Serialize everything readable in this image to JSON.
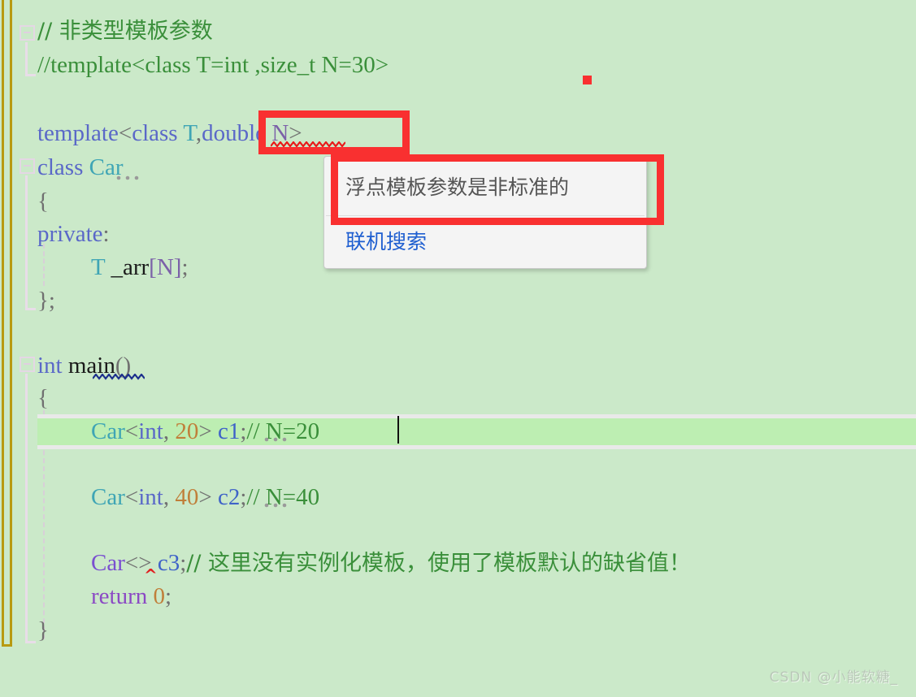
{
  "editor": {
    "background_color": "#cbe9c9",
    "current_line_color": "#bdeeb2",
    "change_bar_color": "#b89a10",
    "annotation_color": "#f93030"
  },
  "code": {
    "lines": [
      {
        "indent": 0,
        "text": "// 非类型模板参数"
      },
      {
        "indent": 0,
        "text": "//template<class T=int ,size_t N=30>"
      },
      {
        "indent": 0,
        "text": ""
      },
      {
        "indent": 0,
        "text": "template<class T,double N>"
      },
      {
        "indent": 0,
        "text": "class Car"
      },
      {
        "indent": 0,
        "text": "{"
      },
      {
        "indent": 0,
        "text": "private:"
      },
      {
        "indent": 1,
        "text": "T _arr[N];"
      },
      {
        "indent": 0,
        "text": "};"
      },
      {
        "indent": 0,
        "text": ""
      },
      {
        "indent": 0,
        "text": "int main()"
      },
      {
        "indent": 0,
        "text": "{"
      },
      {
        "indent": 1,
        "text": "Car<int, 20> c1;// N=20"
      },
      {
        "indent": 1,
        "text": ""
      },
      {
        "indent": 1,
        "text": "Car<int, 40> c2;// N=40"
      },
      {
        "indent": 1,
        "text": ""
      },
      {
        "indent": 1,
        "text": "Car<> c3;// 这里没有实例化模板，使用了模板默认的缺省值！"
      },
      {
        "indent": 1,
        "text": "return 0;"
      },
      {
        "indent": 0,
        "text": "}"
      }
    ],
    "tokens": {
      "comment_line_1": "// 非类型模板参数",
      "comment_line_2": "//template<class T=int ,size_t N=30>",
      "kw_template": "template",
      "lt": "<",
      "kw_class": "class",
      "t_param": "T",
      "comma": ",",
      "kw_double": "double",
      "n_param": "N",
      "gt": ">",
      "class_name": "Car",
      "open_brace": "{",
      "kw_private": "private",
      "colon": ":",
      "member_type": "T",
      "member_name": "_arr",
      "bracket_open": "[",
      "bracket_n": "N",
      "bracket_close": "]",
      "semi": ";",
      "close_brace_semi": "};",
      "kw_int": "int",
      "fn_main": "main",
      "parens": "()",
      "car": "Car",
      "int_arg": "int",
      "num_20": "20",
      "num_40": "40",
      "var_c1": "c1",
      "var_c2": "c2",
      "var_c3": "c3",
      "cmt_n20": "// N=20",
      "cmt_n40": "// N=40",
      "cmt_c3": "// 这里没有实例化模板，使用了模板默认的缺省值！",
      "kw_return": "return",
      "num_0": "0",
      "close_brace": "}",
      "empty_args": "<>"
    }
  },
  "tooltip": {
    "message": "浮点模板参数是非标准的",
    "link_label": "联机搜索"
  },
  "watermark": {
    "text": "CSDN @小能软糖_"
  }
}
